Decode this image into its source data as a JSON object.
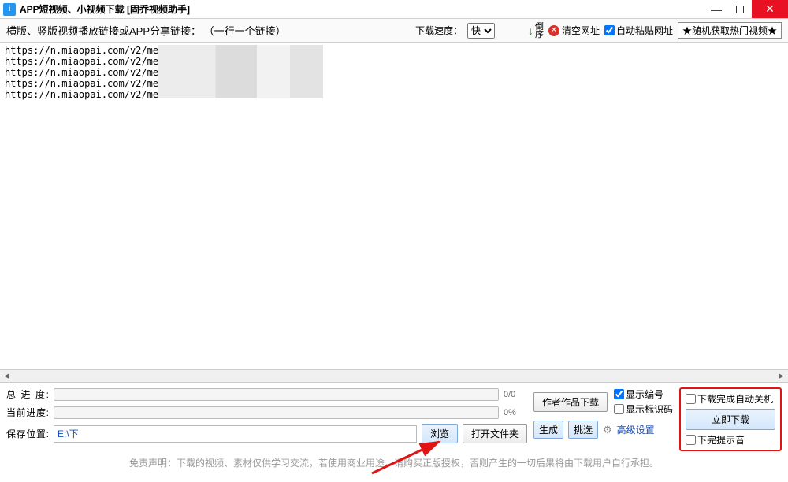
{
  "window": {
    "title": "APP短视频、小视频下载 [固乔视频助手]",
    "app_icon_letter": "i"
  },
  "toolbar": {
    "main_label": "横版、竖版视频播放链接或APP分享链接： （一行一个链接）",
    "speed_label": "下载速度：",
    "speed_value": "快",
    "sort_label": "倒序",
    "clear_label": "清空网址",
    "auto_paste_label": "自动粘贴网址",
    "random_hot_label": "★随机获取热门视频★"
  },
  "urls": "https://n.miaopai.com/v2/media/\nhttps://n.miaopai.com/v2/media/l\nhttps://n.miaopai.com/v2/media/\nhttps://n.miaopai.com/v2/medi.\nhttps://n.miaopai.com/v2/media",
  "progress": {
    "total_label": "总 进 度:",
    "total_value": "0/0",
    "current_label": "当前进度:",
    "current_value": "0%"
  },
  "save": {
    "label": "保存位置:",
    "path": "E:\\下",
    "browse": "浏览",
    "open_folder": "打开文件夹"
  },
  "mid": {
    "author_works": "作者作品下载",
    "show_number": "显示编号",
    "show_marker": "显示标识码",
    "generate": "生成",
    "filter": "挑选",
    "advanced": "高级设置"
  },
  "right": {
    "auto_shutdown": "下载完成自动关机",
    "download_now": "立即下载",
    "sound_tip": "下完提示音"
  },
  "disclaimer": "免责声明：下载的视频、素材仅供学习交流，若使用商业用途，请购买正版授权，否则产生的一切后果将由下载用户自行承担。"
}
